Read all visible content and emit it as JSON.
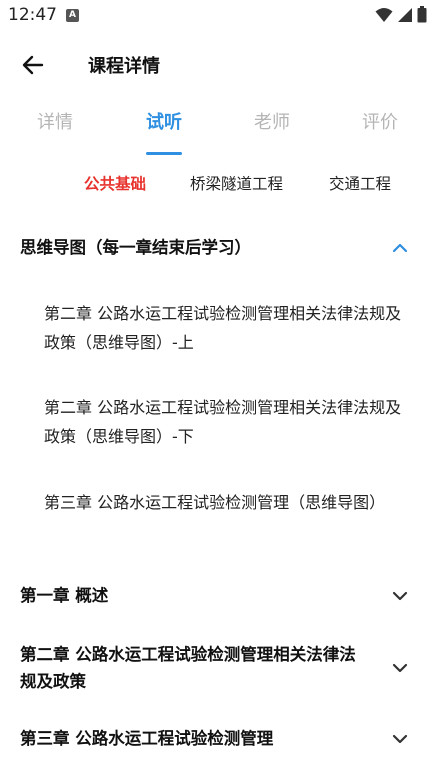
{
  "status": {
    "time": "12:47",
    "notif_icon_letter": "A",
    "icons": [
      "wifi-icon",
      "signal-icon",
      "battery-icon"
    ]
  },
  "header": {
    "title": "课程详情",
    "back_icon": "arrow-left-icon"
  },
  "tabs": [
    {
      "label": "详情",
      "active": false
    },
    {
      "label": "试听",
      "active": true
    },
    {
      "label": "老师",
      "active": false
    },
    {
      "label": "评价",
      "active": false
    }
  ],
  "subtabs": [
    {
      "label": "公共基础",
      "active": true
    },
    {
      "label": "桥梁隧道工程",
      "active": false
    },
    {
      "label": "交通工程",
      "active": false
    }
  ],
  "sections": [
    {
      "title": "思维导图（每一章结束后学习）",
      "expanded": true,
      "items": [
        "第二章 公路水运工程试验检测管理相关法律法规及政策（思维导图）-上",
        "第二章 公路水运工程试验检测管理相关法律法规及政策（思维导图）-下",
        "第三章 公路水运工程试验检测管理（思维导图）"
      ]
    },
    {
      "title": "第一章 概述",
      "expanded": false
    },
    {
      "title": "第二章 公路水运工程试验检测管理相关法律法规及政策",
      "expanded": false
    },
    {
      "title": "第三章 公路水运工程试验检测管理",
      "expanded": false
    }
  ],
  "colors": {
    "accent_blue": "#2f8fe0",
    "active_red": "#e8322d",
    "inactive_tab": "#b5b5b5"
  }
}
